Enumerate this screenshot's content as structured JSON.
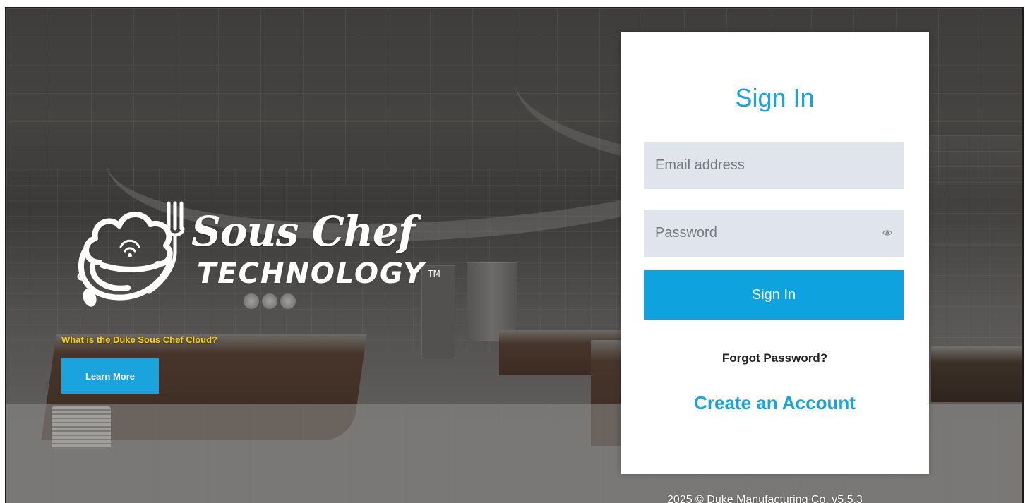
{
  "brand": {
    "wordmark": "Sous Chef",
    "subword": "TECHNOLOGY",
    "trademark": "TM"
  },
  "promo": {
    "question": "What is the Duke Sous Chef Cloud?",
    "learn_more_label": "Learn More"
  },
  "signin": {
    "title": "Sign In",
    "email_placeholder": "Email address",
    "email_value": "",
    "password_placeholder": "Password",
    "password_value": "",
    "password_toggle_icon": "eye-icon",
    "submit_label": "Sign In",
    "forgot_label": "Forgot Password?",
    "create_label": "Create an Account"
  },
  "footer": {
    "text": "2025 © Duke Manufacturing Co. v5.5.3"
  },
  "colors": {
    "accent": "#1aa3dc",
    "promo_text": "#ffd200",
    "field_bg": "#e0e4ec"
  }
}
